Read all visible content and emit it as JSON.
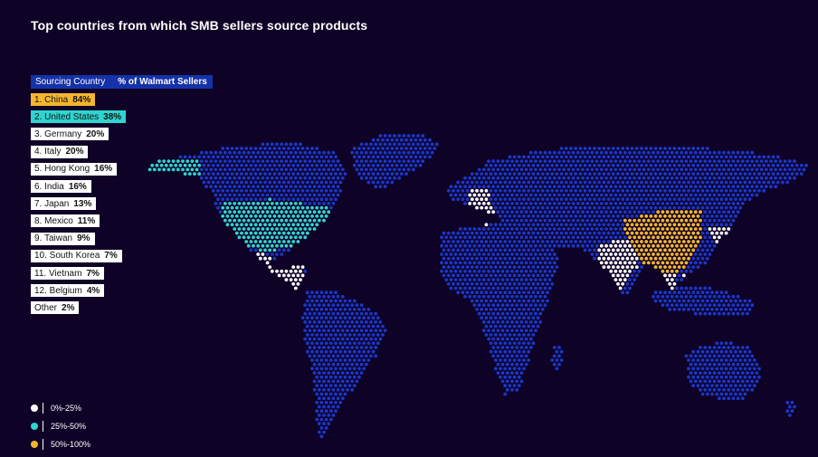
{
  "title": "Top countries from which SMB sellers source products",
  "table_header": {
    "country": "Sourcing Country",
    "percent": "% of Walmart Sellers"
  },
  "colors": {
    "background": "#0f0227",
    "map_dot": "#1a37c8",
    "tier_low": "#ffffff",
    "tier_mid": "#2fd4cf",
    "tier_high": "#f5b52e"
  },
  "chart_data": {
    "type": "table",
    "title": "Top countries from which SMB sellers source products",
    "columns": [
      "Sourcing Country",
      "% of Walmart Sellers"
    ],
    "rows": [
      {
        "rank": "1.",
        "country": "China",
        "percent": "84%",
        "value": 84,
        "tier": "high"
      },
      {
        "rank": "2.",
        "country": "United States",
        "percent": "38%",
        "value": 38,
        "tier": "mid"
      },
      {
        "rank": "3.",
        "country": "Germany",
        "percent": "20%",
        "value": 20,
        "tier": "low"
      },
      {
        "rank": "4.",
        "country": "Italy",
        "percent": "20%",
        "value": 20,
        "tier": "low"
      },
      {
        "rank": "5.",
        "country": "Hong Kong",
        "percent": "16%",
        "value": 16,
        "tier": "low"
      },
      {
        "rank": "6.",
        "country": "India",
        "percent": "16%",
        "value": 16,
        "tier": "low"
      },
      {
        "rank": "7.",
        "country": "Japan",
        "percent": "13%",
        "value": 13,
        "tier": "low"
      },
      {
        "rank": "8.",
        "country": "Mexico",
        "percent": "11%",
        "value": 11,
        "tier": "low"
      },
      {
        "rank": "9.",
        "country": "Taiwan",
        "percent": "9%",
        "value": 9,
        "tier": "low"
      },
      {
        "rank": "10.",
        "country": "South Korea",
        "percent": "7%",
        "value": 7,
        "tier": "low"
      },
      {
        "rank": "11.",
        "country": "Vietnam",
        "percent": "7%",
        "value": 7,
        "tier": "low"
      },
      {
        "rank": "12.",
        "country": "Belgium",
        "percent": "4%",
        "value": 4,
        "tier": "low"
      },
      {
        "rank": "",
        "country": "Other",
        "percent": "2%",
        "value": 2,
        "tier": "low"
      }
    ],
    "legend": [
      {
        "label": "0%-25%",
        "tier": "low"
      },
      {
        "label": "25%-50%",
        "tier": "mid"
      },
      {
        "label": "50%-100%",
        "tier": "high"
      }
    ]
  }
}
